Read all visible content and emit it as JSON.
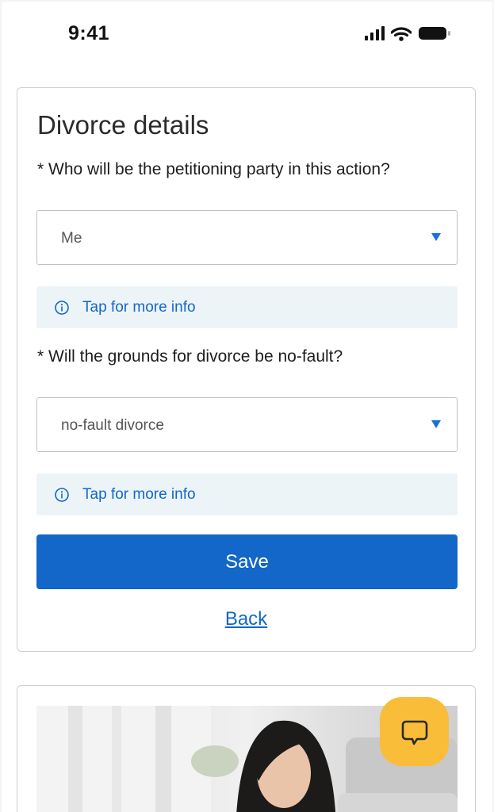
{
  "status_bar": {
    "time": "9:41",
    "icons": [
      "signal-icon",
      "wifi-icon",
      "battery-icon"
    ]
  },
  "form": {
    "title": "Divorce details",
    "questions": [
      {
        "label": "* Who will be the petitioning party in this action?",
        "selected": "Me",
        "info_label": "Tap for more info"
      },
      {
        "label": "* Will the grounds for divorce be no-fault?",
        "selected": "no-fault divorce",
        "info_label": "Tap for more info"
      }
    ],
    "save_label": "Save",
    "back_label": "Back"
  },
  "chat": {
    "icon": "chat-bubble-icon"
  },
  "colors": {
    "primary": "#1267c8",
    "info_bg": "#edf4f8",
    "chat_fab": "#f9bd3a"
  }
}
